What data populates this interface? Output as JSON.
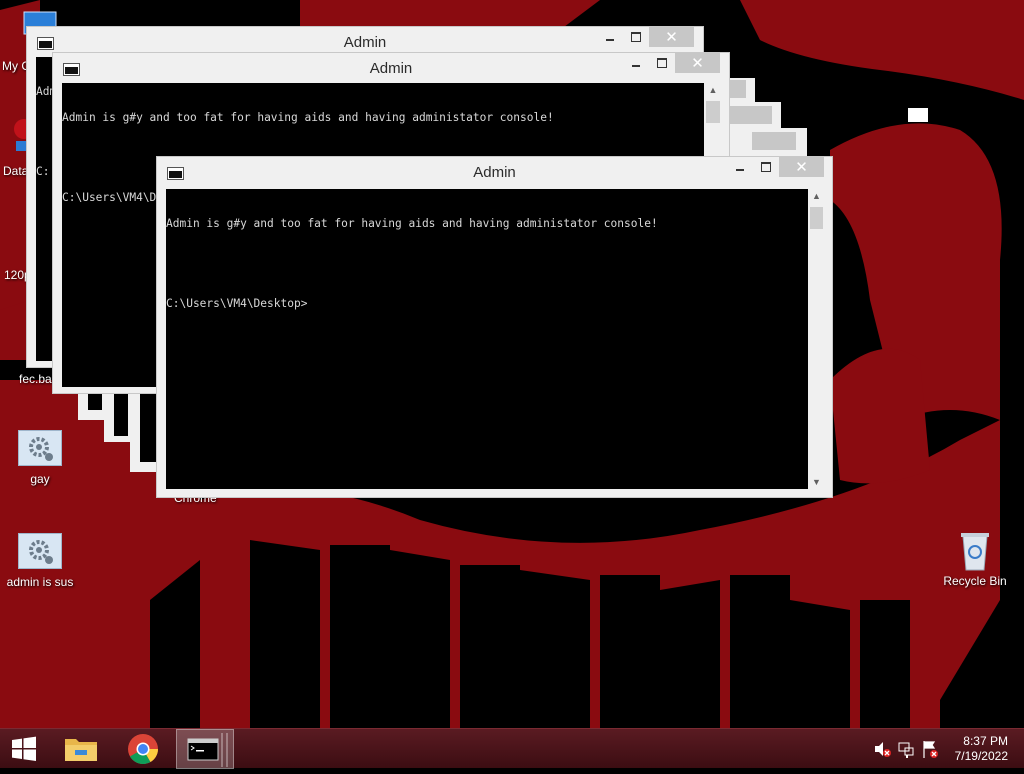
{
  "desktop": {
    "icons": [
      {
        "label": "gay"
      },
      {
        "label": "admin is sus"
      },
      {
        "label": "Recycle Bin"
      }
    ],
    "partial_labels": [
      "My C",
      "Data",
      "120p",
      "fec.ba",
      "Chrome"
    ]
  },
  "windows": {
    "title": "Admin",
    "console_message": "Admin is g#y and too fat for having aids and having administator console!",
    "prompt": "C:\\Users\\VM4\\Desktop>",
    "partial_message": "Adm",
    "partial_prompt": "C:"
  },
  "window_buttons": {
    "close_glyph": "✕"
  },
  "taskbar": {
    "clock_time": "8:37 PM",
    "clock_date": "7/19/2022",
    "items": [
      "start-icon",
      "file-explorer-icon",
      "chrome-icon",
      "command-prompt-icon"
    ],
    "tray_icons": [
      "speaker-muted-icon",
      "network-icon",
      "action-center-icon"
    ]
  },
  "colors": {
    "wallpaper_red": "#8a0b10",
    "console_bg": "#000000",
    "console_text": "#d8d8d8",
    "taskbar": "#4a1419"
  }
}
